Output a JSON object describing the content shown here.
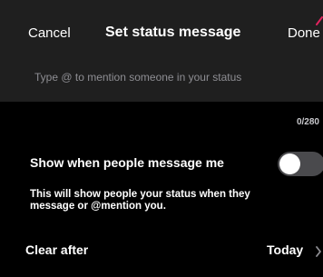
{
  "header": {
    "cancel_label": "Cancel",
    "title": "Set status message",
    "done_label": "Done"
  },
  "input": {
    "value": "",
    "placeholder": "Type @ to mention someone in your status"
  },
  "counter": "0/280",
  "show_setting": {
    "label": "Show when people message me",
    "enabled": false,
    "description": "This will show people your status when they message or @mention you."
  },
  "clear_after": {
    "label": "Clear after",
    "value": "Today"
  },
  "colors": {
    "background": "#000000",
    "panel": "#1f1f1f",
    "toggle_off": "#4a4a4d",
    "accent_mark": "#e0245e"
  },
  "icons": [
    "chevron-right-icon"
  ]
}
